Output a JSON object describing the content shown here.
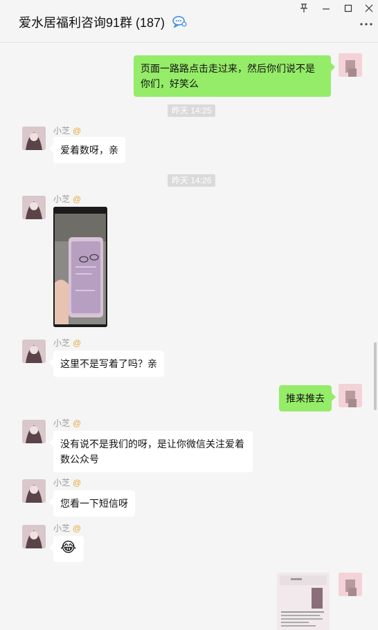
{
  "window": {
    "title": "爱水居福利咨询91群 (187)",
    "controls": [
      "pin-icon",
      "minimize-icon",
      "maximize-icon",
      "close-icon"
    ],
    "more_icon": "more-icon"
  },
  "messages": [
    {
      "type": "outgoing",
      "text": "页面一路路点击走过来，然后你们说不是你们，好笑么"
    },
    {
      "type": "timestamp",
      "text": "昨天 14:25"
    },
    {
      "type": "incoming",
      "sender": "小芝",
      "mention": "@",
      "text": "爱着数呀，亲"
    },
    {
      "type": "timestamp",
      "text": "昨天 14:26"
    },
    {
      "type": "incoming-image",
      "sender": "小芝",
      "mention": "@",
      "image": "phone-screenshot-photo"
    },
    {
      "type": "incoming",
      "sender": "小芝",
      "mention": "@",
      "text": "这里不是写着了吗？亲"
    },
    {
      "type": "outgoing",
      "text": "推来推去"
    },
    {
      "type": "incoming",
      "sender": "小芝",
      "mention": "@",
      "text": "没有说不是我们的呀，是让你微信关注爱着数公众号"
    },
    {
      "type": "incoming",
      "sender": "小芝",
      "mention": "@",
      "text": "您看一下短信呀"
    },
    {
      "type": "incoming-emoji",
      "sender": "小芝",
      "mention": "@",
      "emoji": "😂"
    },
    {
      "type": "outgoing-image",
      "image": "sms-screenshot-photo"
    }
  ],
  "colors": {
    "outgoing_bubble": "#95ec69",
    "incoming_bubble": "#ffffff",
    "background": "#f5f5f5",
    "mention": "#e3a83a"
  }
}
